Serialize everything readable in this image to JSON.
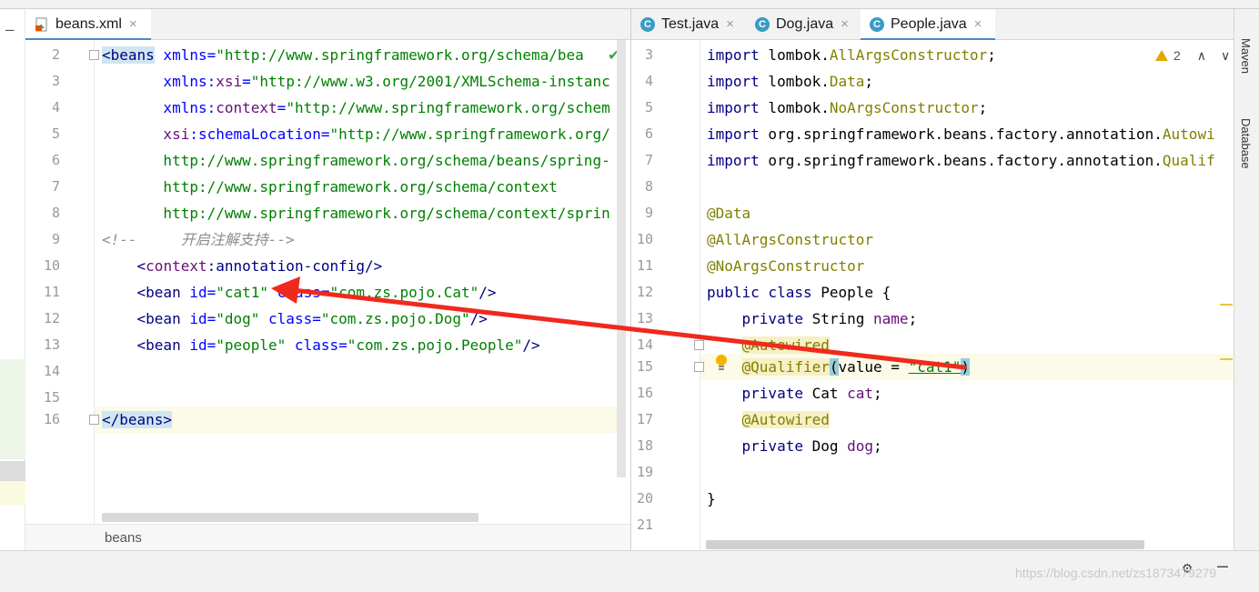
{
  "left_tabs": [
    {
      "label": "beans.xml",
      "icon": "xml-file-icon",
      "active": true
    }
  ],
  "right_tabs": [
    {
      "label": "Test.java",
      "icon": "java-class-icon",
      "active": false
    },
    {
      "label": "Dog.java",
      "icon": "java-class-icon",
      "active": false
    },
    {
      "label": "People.java",
      "icon": "java-class-icon",
      "active": true
    }
  ],
  "class_icon_letter": "C",
  "close_glyph": "×",
  "breadcrumb": "beans",
  "inspection": {
    "warnings": "2"
  },
  "tool_windows": [
    "Maven",
    "Database"
  ],
  "watermark": "https://blog.csdn.net/zs1873479279",
  "xml_lines": [
    {
      "n": "2"
    },
    {
      "n": "3"
    },
    {
      "n": "4"
    },
    {
      "n": "5"
    },
    {
      "n": "6"
    },
    {
      "n": "7"
    },
    {
      "n": "8"
    },
    {
      "n": "9"
    },
    {
      "n": "10"
    },
    {
      "n": "11"
    },
    {
      "n": "12"
    },
    {
      "n": "13"
    },
    {
      "n": "14"
    },
    {
      "n": "15"
    },
    {
      "n": "16"
    }
  ],
  "xml_text": {
    "l2a": "<beans",
    "l2b": " xmlns=",
    "l2c": "\"http://www.springframework.org/schema/bea",
    "l3a": "       xmlns:",
    "l3b": "xsi",
    "l3c": "=",
    "l3d": "\"http://www.w3.org/2001/XMLSchema-instanc",
    "l4a": "       xmlns:",
    "l4b": "context",
    "l4c": "=",
    "l4d": "\"http://www.springframework.org/schem",
    "l5a": "       xsi",
    "l5b": ":schemaLocation=",
    "l5c": "\"http://www.springframework.org/",
    "l6": "       http://www.springframework.org/schema/beans/spring-",
    "l7": "       http://www.springframework.org/schema/context",
    "l8": "       http://www.springframework.org/schema/context/sprin",
    "l9": "<!--     开启注解支持-->",
    "l10a": "    <",
    "l10b": "context",
    "l10c": ":annotation-config/>",
    "l11a": "    <bean",
    "l11b": " id=",
    "l11c": "\"cat1\"",
    "l11d": " class=",
    "l11e": "\"com.zs.pojo.Cat\"",
    "l11f": "/>",
    "l12a": "    <bean",
    "l12b": " id=",
    "l12c": "\"dog\"",
    "l12d": " class=",
    "l12e": "\"com.zs.pojo.Dog\"",
    "l12f": "/>",
    "l13a": "    <bean",
    "l13b": " id=",
    "l13c": "\"people\"",
    "l13d": " class=",
    "l13e": "\"com.zs.pojo.People\"",
    "l13f": "/>",
    "l16": "</beans>"
  },
  "java_lines": [
    {
      "n": "3"
    },
    {
      "n": "4"
    },
    {
      "n": "5"
    },
    {
      "n": "6"
    },
    {
      "n": "7"
    },
    {
      "n": "8"
    },
    {
      "n": "9"
    },
    {
      "n": "10"
    },
    {
      "n": "11"
    },
    {
      "n": "12"
    },
    {
      "n": "13"
    },
    {
      "n": "14"
    },
    {
      "n": "15"
    },
    {
      "n": "16"
    },
    {
      "n": "17"
    },
    {
      "n": "18"
    },
    {
      "n": "19"
    },
    {
      "n": "20"
    },
    {
      "n": "21"
    }
  ],
  "java_text": {
    "kw_import": "import",
    "j3a": " lombok.",
    "j3b": "AllArgsConstructor",
    "j3c": ";",
    "j4a": " lombok.",
    "j4b": "Data",
    "j4c": ";",
    "j5a": " lombok.",
    "j5b": "NoArgsConstructor",
    "j5c": ";",
    "j6a": " org.springframework.beans.factory.annotation.",
    "j6b": "Autowi",
    "j7a": " org.springframework.beans.factory.annotation.",
    "j7b": "Qualif",
    "j9": "@Data",
    "j10": "@AllArgsConstructor",
    "j11": "@NoArgsConstructor",
    "j12a": "public class",
    "j12b": " People {",
    "j13a": "    private",
    "j13b": " String ",
    "j13c": "name",
    "j13d": ";",
    "j14": "@Autowired",
    "j15a": "@Qualifier",
    "j15b": "(",
    "j15c": "value = ",
    "j15d": "\"cat1\"",
    "j15e": ")",
    "j16a": "    private",
    "j16b": " Cat ",
    "j16c": "cat",
    "j16d": ";",
    "j17": "@Autowired",
    "j18a": "    private",
    "j18b": " Dog ",
    "j18c": "dog",
    "j18d": ";",
    "j20": "}",
    "indent": "    "
  },
  "colors": {
    "annotation_arrow": "#f0291d",
    "tab_active_underline": "#4a88c7"
  }
}
